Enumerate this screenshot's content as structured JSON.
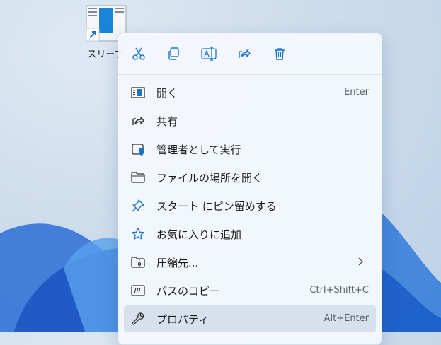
{
  "desktop": {
    "shortcut_label": "スリープ"
  },
  "context_menu": {
    "toolbar": [
      {
        "icon": "scissors-icon",
        "label": "Cut"
      },
      {
        "icon": "copy-icon",
        "label": "Copy"
      },
      {
        "icon": "rename-icon",
        "label": "Rename"
      },
      {
        "icon": "share-icon",
        "label": "Share"
      },
      {
        "icon": "trash-icon",
        "label": "Delete"
      }
    ],
    "items": [
      {
        "icon": "open-window-icon",
        "label": "開く",
        "shortcut": "Enter"
      },
      {
        "icon": "share-icon",
        "label": "共有",
        "shortcut": ""
      },
      {
        "icon": "admin-shield-icon",
        "label": "管理者として実行",
        "shortcut": ""
      },
      {
        "icon": "folder-icon",
        "label": "ファイルの場所を開く",
        "shortcut": ""
      },
      {
        "icon": "pin-icon",
        "label": "スタート にピン留めする",
        "shortcut": ""
      },
      {
        "icon": "star-icon",
        "label": "お気に入りに追加",
        "shortcut": ""
      },
      {
        "icon": "zip-folder-icon",
        "label": "圧縮先...",
        "shortcut": "",
        "has_submenu": true
      },
      {
        "icon": "copy-path-icon",
        "label": "パスのコピー",
        "shortcut": "Ctrl+Shift+C"
      },
      {
        "icon": "wrench-icon",
        "label": "プロパティ",
        "shortcut": "Alt+Enter"
      }
    ],
    "accent_color": "#1a73c8"
  }
}
